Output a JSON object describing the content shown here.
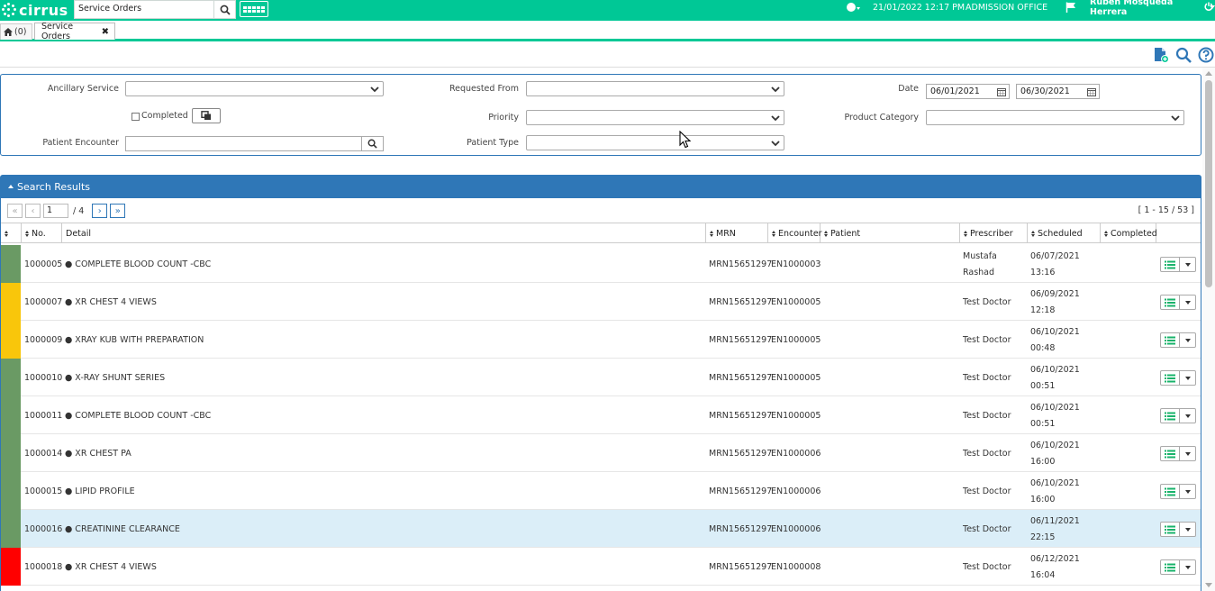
{
  "app": {
    "logo_text": "cirrus",
    "search_value": "Service Orders",
    "datetime": "21/01/2022 12:17 PM",
    "location": "ADMISSION OFFICE",
    "user": "Ruben Mosqueda Herrera",
    "brand_color": "#00c896",
    "accent_color": "#2f77b7"
  },
  "tabs": {
    "home_label": "(0)",
    "active_label": "Service Orders",
    "close_glyph": "✖"
  },
  "filters": {
    "ancillary_label": "Ancillary Service",
    "ancillary_value": "",
    "requested_from_label": "Requested From",
    "requested_from_value": "",
    "date_label": "Date",
    "date_from": "06/01/2021",
    "date_to": "06/30/2021",
    "completed_label": "Completed",
    "priority_label": "Priority",
    "priority_value": "",
    "product_category_label": "Product Category",
    "product_category_value": "",
    "patient_encounter_label": "Patient Encounter",
    "patient_encounter_value": "",
    "patient_type_label": "Patient Type",
    "patient_type_value": ""
  },
  "results": {
    "title": "Search Results",
    "page_current": "1",
    "page_total": "/ 4",
    "range": "[ 1 - 15 / 53 ]",
    "columns": [
      "",
      "No.",
      "Detail",
      "MRN",
      "Encounter",
      "Patient",
      "Prescriber",
      "Scheduled",
      "Completed"
    ],
    "rows": [
      {
        "color": "#6a9a64",
        "no": "1000005",
        "detail": "● COMPLETE BLOOD COUNT -CBC",
        "mrn": "MRN15651297",
        "encounter": "EN1000003",
        "patient": "",
        "prescriber_1": "Mustafa",
        "prescriber_2": "Rashad",
        "sched_date": "06/07/2021",
        "sched_time": "13:16",
        "completed": ""
      },
      {
        "color": "#f9c60b",
        "no": "1000007",
        "detail": "● XR CHEST 4 VIEWS",
        "mrn": "MRN15651297",
        "encounter": "EN1000005",
        "patient": "",
        "prescriber_1": "Test Doctor",
        "prescriber_2": "",
        "sched_date": "06/09/2021",
        "sched_time": "12:18",
        "completed": ""
      },
      {
        "color": "#f9c60b",
        "no": "1000009",
        "detail": "● XRAY KUB WITH PREPARATION",
        "mrn": "MRN15651297",
        "encounter": "EN1000005",
        "patient": "",
        "prescriber_1": "Test Doctor",
        "prescriber_2": "",
        "sched_date": "06/10/2021",
        "sched_time": "00:48",
        "completed": ""
      },
      {
        "color": "#6a9a64",
        "no": "1000010",
        "detail": "● X-RAY SHUNT SERIES",
        "mrn": "MRN15651297",
        "encounter": "EN1000005",
        "patient": "",
        "prescriber_1": "Test Doctor",
        "prescriber_2": "",
        "sched_date": "06/10/2021",
        "sched_time": "00:51",
        "completed": ""
      },
      {
        "color": "#6a9a64",
        "no": "1000011",
        "detail": "● COMPLETE BLOOD COUNT -CBC",
        "mrn": "MRN15651297",
        "encounter": "EN1000005",
        "patient": "",
        "prescriber_1": "Test Doctor",
        "prescriber_2": "",
        "sched_date": "06/10/2021",
        "sched_time": "00:51",
        "completed": ""
      },
      {
        "color": "#6a9a64",
        "no": "1000014",
        "detail": "● XR CHEST PA",
        "mrn": "MRN15651297",
        "encounter": "EN1000006",
        "patient": "",
        "prescriber_1": "Test Doctor",
        "prescriber_2": "",
        "sched_date": "06/10/2021",
        "sched_time": "16:00",
        "completed": ""
      },
      {
        "color": "#6a9a64",
        "no": "1000015",
        "detail": "● LIPID PROFILE",
        "mrn": "MRN15651297",
        "encounter": "EN1000006",
        "patient": "",
        "prescriber_1": "Test Doctor",
        "prescriber_2": "",
        "sched_date": "06/10/2021",
        "sched_time": "16:00",
        "completed": ""
      },
      {
        "color": "#6a9a64",
        "no": "1000016",
        "detail": "● CREATININE CLEARANCE",
        "mrn": "MRN15651297",
        "encounter": "EN1000006",
        "patient": "",
        "prescriber_1": "Test Doctor",
        "prescriber_2": "",
        "sched_date": "06/11/2021",
        "sched_time": "22:15",
        "completed": "",
        "highlight": true
      },
      {
        "color": "#ff0000",
        "no": "1000018",
        "detail": "● XR CHEST 4 VIEWS",
        "mrn": "MRN15651297",
        "encounter": "EN1000008",
        "patient": "",
        "prescriber_1": "Test Doctor",
        "prescriber_2": "",
        "sched_date": "06/12/2021",
        "sched_time": "16:04",
        "completed": ""
      }
    ]
  }
}
